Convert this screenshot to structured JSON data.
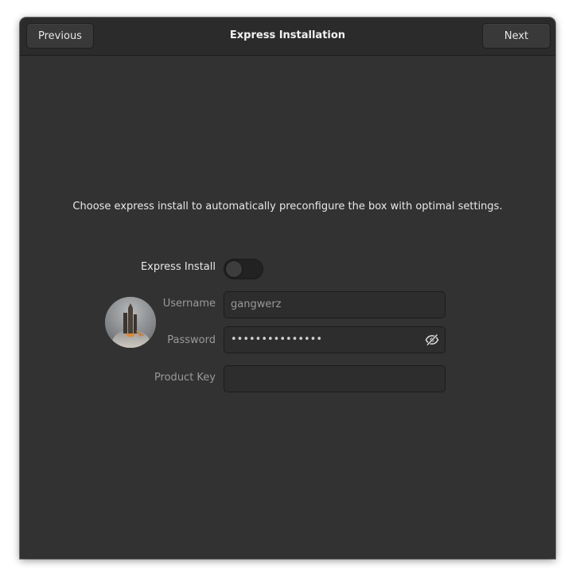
{
  "header": {
    "title": "Express Installation",
    "previous_label": "Previous",
    "next_label": "Next"
  },
  "main": {
    "description": "Choose express install to automatically preconfigure the box with optimal settings.",
    "express_install": {
      "label": "Express Install",
      "enabled": false
    },
    "username": {
      "label": "Username",
      "value": "gangwerz"
    },
    "password": {
      "label": "Password",
      "masked_value": "•••••••••••••••",
      "reveal_icon": "eye-slash-icon"
    },
    "product_key": {
      "label": "Product Key",
      "value": ""
    },
    "avatar_icon": "user-avatar"
  },
  "colors": {
    "window_bg": "#323232",
    "headerbar_bg": "#2b2b2b",
    "entry_bg": "#2d2d2d",
    "text_primary": "#e8e8e8",
    "text_dim": "#9a9a9a"
  }
}
